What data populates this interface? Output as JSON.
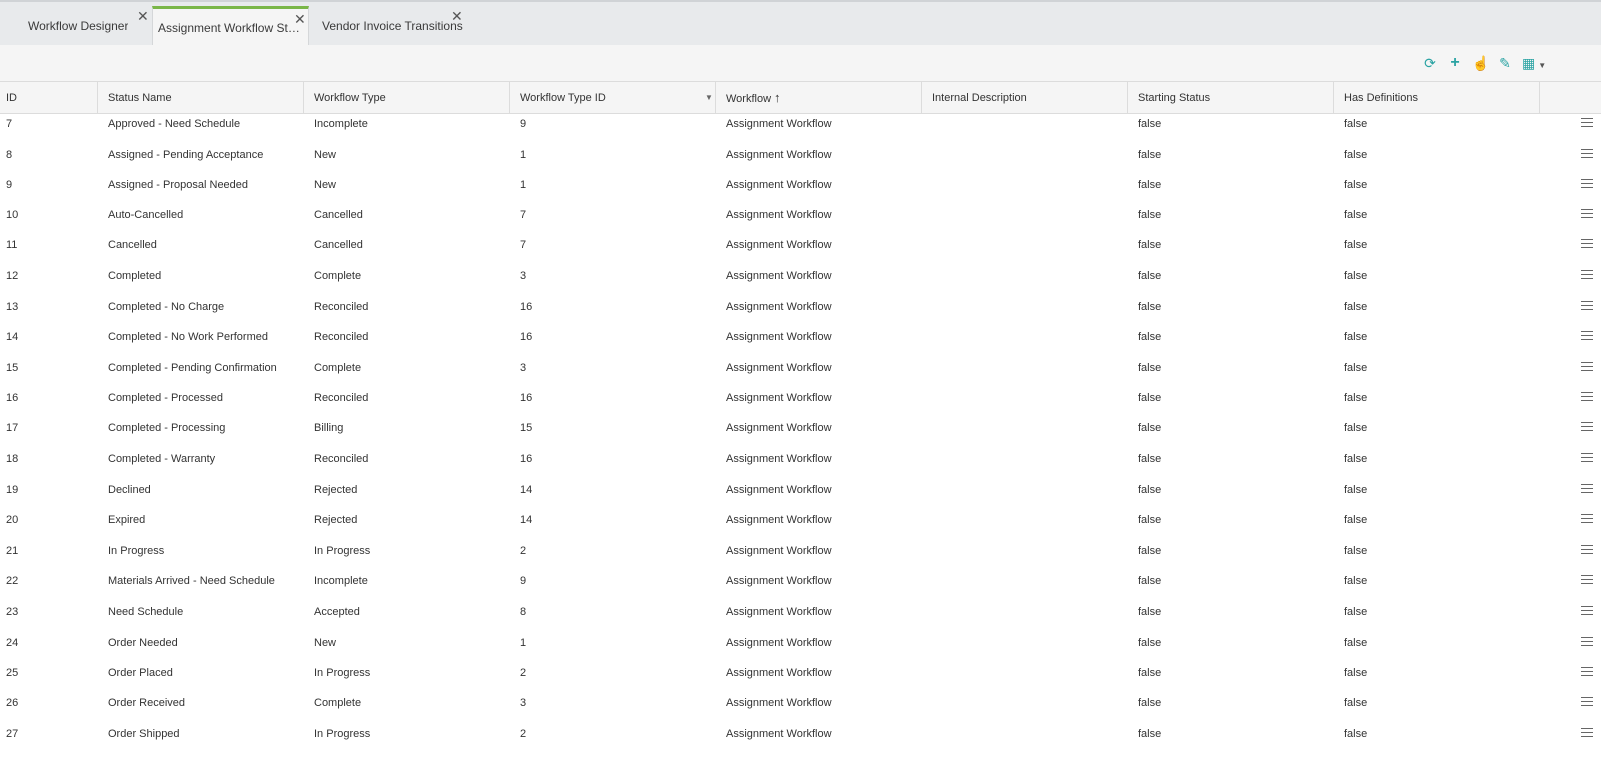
{
  "tabs": [
    {
      "label": "Workflow Designer",
      "active": false
    },
    {
      "label": "Assignment Workflow Statu...",
      "active": true
    },
    {
      "label": "Vendor Invoice Transitions",
      "active": false
    }
  ],
  "toolbar": {
    "icons": [
      "refresh-icon",
      "add-icon",
      "hand-pointer-icon",
      "edit-pencil-icon",
      "grid-columns-icon"
    ]
  },
  "colors": {
    "accent": "#2aa3a3",
    "active_tab_border": "#7ab648"
  },
  "columns": [
    "ID",
    "Status Name",
    "Workflow Type",
    "Workflow Type ID",
    "Workflow",
    "Internal Description",
    "Starting Status",
    "Has Definitions"
  ],
  "sort": {
    "column": "Workflow",
    "direction": "ascending"
  },
  "rows": [
    [
      "7",
      "Approved - Need Schedule",
      "Incomplete",
      "9",
      "Assignment Workflow",
      "",
      "false",
      "false"
    ],
    [
      "8",
      "Assigned - Pending Acceptance",
      "New",
      "1",
      "Assignment Workflow",
      "",
      "false",
      "false"
    ],
    [
      "9",
      "Assigned - Proposal Needed",
      "New",
      "1",
      "Assignment Workflow",
      "",
      "false",
      "false"
    ],
    [
      "10",
      "Auto-Cancelled",
      "Cancelled",
      "7",
      "Assignment Workflow",
      "",
      "false",
      "false"
    ],
    [
      "11",
      "Cancelled",
      "Cancelled",
      "7",
      "Assignment Workflow",
      "",
      "false",
      "false"
    ],
    [
      "12",
      "Completed",
      "Complete",
      "3",
      "Assignment Workflow",
      "",
      "false",
      "false"
    ],
    [
      "13",
      "Completed - No Charge",
      "Reconciled",
      "16",
      "Assignment Workflow",
      "",
      "false",
      "false"
    ],
    [
      "14",
      "Completed - No Work Performed",
      "Reconciled",
      "16",
      "Assignment Workflow",
      "",
      "false",
      "false"
    ],
    [
      "15",
      "Completed - Pending Confirmation",
      "Complete",
      "3",
      "Assignment Workflow",
      "",
      "false",
      "false"
    ],
    [
      "16",
      "Completed - Processed",
      "Reconciled",
      "16",
      "Assignment Workflow",
      "",
      "false",
      "false"
    ],
    [
      "17",
      "Completed - Processing",
      "Billing",
      "15",
      "Assignment Workflow",
      "",
      "false",
      "false"
    ],
    [
      "18",
      "Completed - Warranty",
      "Reconciled",
      "16",
      "Assignment Workflow",
      "",
      "false",
      "false"
    ],
    [
      "19",
      "Declined",
      "Rejected",
      "14",
      "Assignment Workflow",
      "",
      "false",
      "false"
    ],
    [
      "20",
      "Expired",
      "Rejected",
      "14",
      "Assignment Workflow",
      "",
      "false",
      "false"
    ],
    [
      "21",
      "In Progress",
      "In Progress",
      "2",
      "Assignment Workflow",
      "",
      "false",
      "false"
    ],
    [
      "22",
      "Materials Arrived - Need Schedule",
      "Incomplete",
      "9",
      "Assignment Workflow",
      "",
      "false",
      "false"
    ],
    [
      "23",
      "Need Schedule",
      "Accepted",
      "8",
      "Assignment Workflow",
      "",
      "false",
      "false"
    ],
    [
      "24",
      "Order Needed",
      "New",
      "1",
      "Assignment Workflow",
      "",
      "false",
      "false"
    ],
    [
      "25",
      "Order Placed",
      "In Progress",
      "2",
      "Assignment Workflow",
      "",
      "false",
      "false"
    ],
    [
      "26",
      "Order Received",
      "Complete",
      "3",
      "Assignment Workflow",
      "",
      "false",
      "false"
    ],
    [
      "27",
      "Order Shipped",
      "In Progress",
      "2",
      "Assignment Workflow",
      "",
      "false",
      "false"
    ]
  ]
}
